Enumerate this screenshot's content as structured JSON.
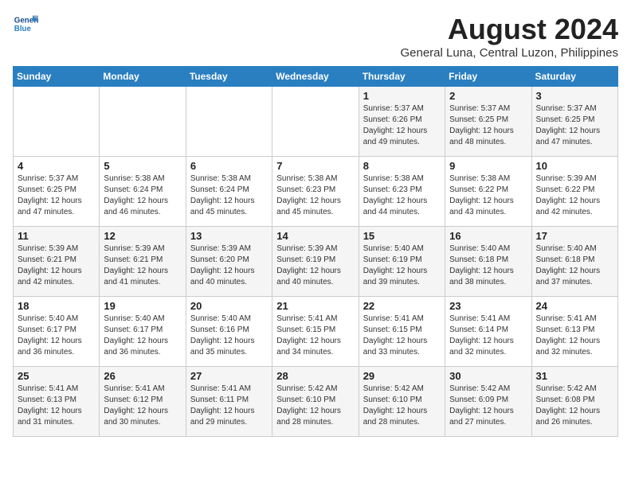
{
  "header": {
    "logo": {
      "line1": "General",
      "line2": "Blue"
    },
    "title": "August 2024",
    "subtitle": "General Luna, Central Luzon, Philippines"
  },
  "weekdays": [
    "Sunday",
    "Monday",
    "Tuesday",
    "Wednesday",
    "Thursday",
    "Friday",
    "Saturday"
  ],
  "weeks": [
    [
      {
        "day": "",
        "info": ""
      },
      {
        "day": "",
        "info": ""
      },
      {
        "day": "",
        "info": ""
      },
      {
        "day": "",
        "info": ""
      },
      {
        "day": "1",
        "info": "Sunrise: 5:37 AM\nSunset: 6:26 PM\nDaylight: 12 hours\nand 49 minutes."
      },
      {
        "day": "2",
        "info": "Sunrise: 5:37 AM\nSunset: 6:25 PM\nDaylight: 12 hours\nand 48 minutes."
      },
      {
        "day": "3",
        "info": "Sunrise: 5:37 AM\nSunset: 6:25 PM\nDaylight: 12 hours\nand 47 minutes."
      }
    ],
    [
      {
        "day": "4",
        "info": "Sunrise: 5:37 AM\nSunset: 6:25 PM\nDaylight: 12 hours\nand 47 minutes."
      },
      {
        "day": "5",
        "info": "Sunrise: 5:38 AM\nSunset: 6:24 PM\nDaylight: 12 hours\nand 46 minutes."
      },
      {
        "day": "6",
        "info": "Sunrise: 5:38 AM\nSunset: 6:24 PM\nDaylight: 12 hours\nand 45 minutes."
      },
      {
        "day": "7",
        "info": "Sunrise: 5:38 AM\nSunset: 6:23 PM\nDaylight: 12 hours\nand 45 minutes."
      },
      {
        "day": "8",
        "info": "Sunrise: 5:38 AM\nSunset: 6:23 PM\nDaylight: 12 hours\nand 44 minutes."
      },
      {
        "day": "9",
        "info": "Sunrise: 5:38 AM\nSunset: 6:22 PM\nDaylight: 12 hours\nand 43 minutes."
      },
      {
        "day": "10",
        "info": "Sunrise: 5:39 AM\nSunset: 6:22 PM\nDaylight: 12 hours\nand 42 minutes."
      }
    ],
    [
      {
        "day": "11",
        "info": "Sunrise: 5:39 AM\nSunset: 6:21 PM\nDaylight: 12 hours\nand 42 minutes."
      },
      {
        "day": "12",
        "info": "Sunrise: 5:39 AM\nSunset: 6:21 PM\nDaylight: 12 hours\nand 41 minutes."
      },
      {
        "day": "13",
        "info": "Sunrise: 5:39 AM\nSunset: 6:20 PM\nDaylight: 12 hours\nand 40 minutes."
      },
      {
        "day": "14",
        "info": "Sunrise: 5:39 AM\nSunset: 6:19 PM\nDaylight: 12 hours\nand 40 minutes."
      },
      {
        "day": "15",
        "info": "Sunrise: 5:40 AM\nSunset: 6:19 PM\nDaylight: 12 hours\nand 39 minutes."
      },
      {
        "day": "16",
        "info": "Sunrise: 5:40 AM\nSunset: 6:18 PM\nDaylight: 12 hours\nand 38 minutes."
      },
      {
        "day": "17",
        "info": "Sunrise: 5:40 AM\nSunset: 6:18 PM\nDaylight: 12 hours\nand 37 minutes."
      }
    ],
    [
      {
        "day": "18",
        "info": "Sunrise: 5:40 AM\nSunset: 6:17 PM\nDaylight: 12 hours\nand 36 minutes."
      },
      {
        "day": "19",
        "info": "Sunrise: 5:40 AM\nSunset: 6:17 PM\nDaylight: 12 hours\nand 36 minutes."
      },
      {
        "day": "20",
        "info": "Sunrise: 5:40 AM\nSunset: 6:16 PM\nDaylight: 12 hours\nand 35 minutes."
      },
      {
        "day": "21",
        "info": "Sunrise: 5:41 AM\nSunset: 6:15 PM\nDaylight: 12 hours\nand 34 minutes."
      },
      {
        "day": "22",
        "info": "Sunrise: 5:41 AM\nSunset: 6:15 PM\nDaylight: 12 hours\nand 33 minutes."
      },
      {
        "day": "23",
        "info": "Sunrise: 5:41 AM\nSunset: 6:14 PM\nDaylight: 12 hours\nand 32 minutes."
      },
      {
        "day": "24",
        "info": "Sunrise: 5:41 AM\nSunset: 6:13 PM\nDaylight: 12 hours\nand 32 minutes."
      }
    ],
    [
      {
        "day": "25",
        "info": "Sunrise: 5:41 AM\nSunset: 6:13 PM\nDaylight: 12 hours\nand 31 minutes."
      },
      {
        "day": "26",
        "info": "Sunrise: 5:41 AM\nSunset: 6:12 PM\nDaylight: 12 hours\nand 30 minutes."
      },
      {
        "day": "27",
        "info": "Sunrise: 5:41 AM\nSunset: 6:11 PM\nDaylight: 12 hours\nand 29 minutes."
      },
      {
        "day": "28",
        "info": "Sunrise: 5:42 AM\nSunset: 6:10 PM\nDaylight: 12 hours\nand 28 minutes."
      },
      {
        "day": "29",
        "info": "Sunrise: 5:42 AM\nSunset: 6:10 PM\nDaylight: 12 hours\nand 28 minutes."
      },
      {
        "day": "30",
        "info": "Sunrise: 5:42 AM\nSunset: 6:09 PM\nDaylight: 12 hours\nand 27 minutes."
      },
      {
        "day": "31",
        "info": "Sunrise: 5:42 AM\nSunset: 6:08 PM\nDaylight: 12 hours\nand 26 minutes."
      }
    ]
  ]
}
